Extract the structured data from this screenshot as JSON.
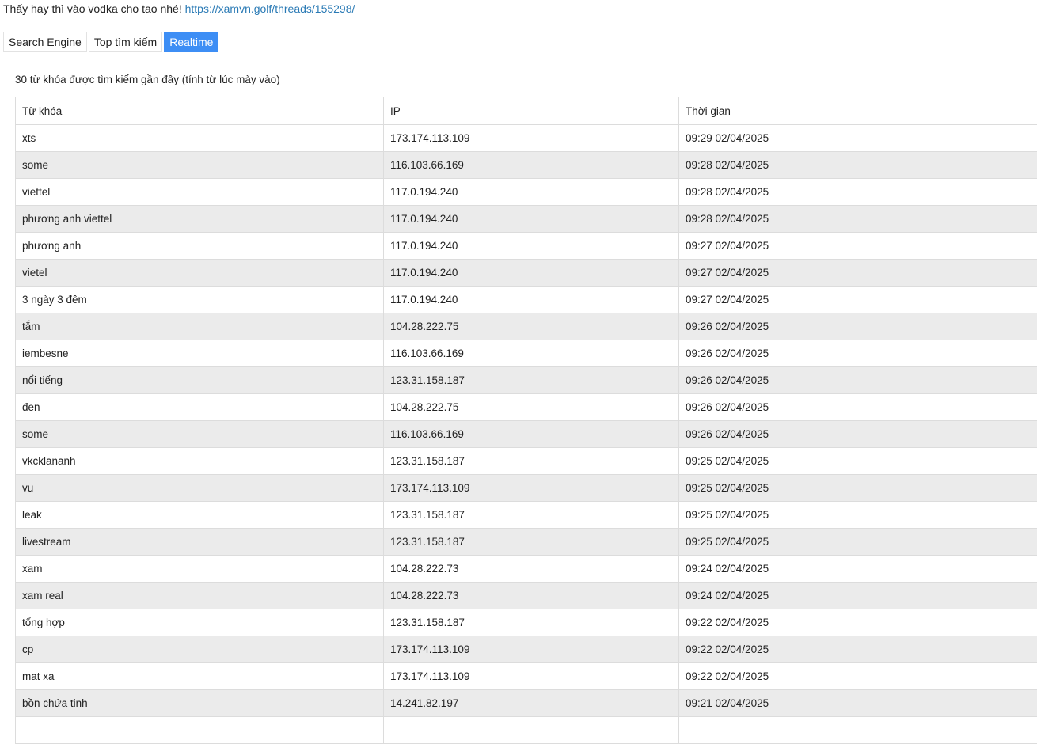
{
  "promo": {
    "text": "Thấy hay thì vào vodka cho tao nhé! ",
    "link": "https://xamvn.golf/threads/155298/"
  },
  "tabs": [
    {
      "label": "Search Engine",
      "active": false
    },
    {
      "label": "Top tìm kiếm",
      "active": false
    },
    {
      "label": "Realtime",
      "active": true
    }
  ],
  "subtitle": "30 từ khóa được tìm kiếm gần đây (tính từ lúc mày vào)",
  "table": {
    "headers": [
      "Từ khóa",
      "IP",
      "Thời gian"
    ],
    "rows": [
      [
        "xts",
        "173.174.113.109",
        "09:29 02/04/2025"
      ],
      [
        "some",
        "116.103.66.169",
        "09:28 02/04/2025"
      ],
      [
        "viettel",
        "117.0.194.240",
        "09:28 02/04/2025"
      ],
      [
        "phương anh viettel",
        "117.0.194.240",
        "09:28 02/04/2025"
      ],
      [
        "phương anh",
        "117.0.194.240",
        "09:27 02/04/2025"
      ],
      [
        "vietel",
        "117.0.194.240",
        "09:27 02/04/2025"
      ],
      [
        "3 ngày 3 đêm",
        "117.0.194.240",
        "09:27 02/04/2025"
      ],
      [
        "tắm",
        "104.28.222.75",
        "09:26 02/04/2025"
      ],
      [
        "iembesne",
        "116.103.66.169",
        "09:26 02/04/2025"
      ],
      [
        "nổi tiếng",
        "123.31.158.187",
        "09:26 02/04/2025"
      ],
      [
        "đen",
        "104.28.222.75",
        "09:26 02/04/2025"
      ],
      [
        "some",
        "116.103.66.169",
        "09:26 02/04/2025"
      ],
      [
        "vkcklananh",
        "123.31.158.187",
        "09:25 02/04/2025"
      ],
      [
        "vu",
        "173.174.113.109",
        "09:25 02/04/2025"
      ],
      [
        "leak",
        "123.31.158.187",
        "09:25 02/04/2025"
      ],
      [
        "livestream",
        "123.31.158.187",
        "09:25 02/04/2025"
      ],
      [
        "xam",
        "104.28.222.73",
        "09:24 02/04/2025"
      ],
      [
        "xam real",
        "104.28.222.73",
        "09:24 02/04/2025"
      ],
      [
        "tổng hợp",
        "123.31.158.187",
        "09:22 02/04/2025"
      ],
      [
        "cp",
        "173.174.113.109",
        "09:22 02/04/2025"
      ],
      [
        "mat xa",
        "173.174.113.109",
        "09:22 02/04/2025"
      ],
      [
        "bồn chứa tinh",
        "14.241.82.197",
        "09:21 02/04/2025"
      ],
      [
        "",
        "",
        ""
      ]
    ]
  }
}
